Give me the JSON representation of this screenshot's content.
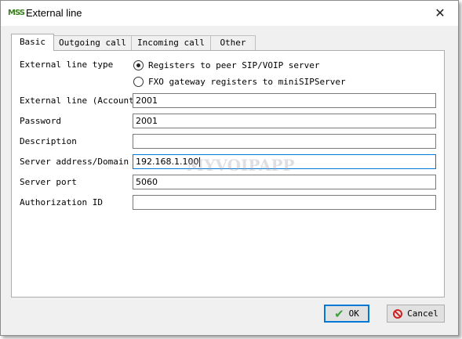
{
  "window": {
    "title": "External line",
    "icon": "mss-logo-icon"
  },
  "tabs": [
    {
      "label": "Basic",
      "active": true
    },
    {
      "label": "Outgoing call",
      "active": false
    },
    {
      "label": "Incoming call",
      "active": false
    },
    {
      "label": "Other",
      "active": false
    }
  ],
  "form": {
    "type_label": "External line type",
    "radio_options": [
      {
        "label": "Registers to peer SIP/VOIP server",
        "checked": true
      },
      {
        "label": "FXO gateway registers to miniSIPServer",
        "checked": false
      }
    ],
    "fields": [
      {
        "label": "External line (Account)",
        "value": "2001"
      },
      {
        "label": "Password",
        "value": "2001"
      },
      {
        "label": "Description",
        "value": ""
      },
      {
        "label": "Server address/Domain",
        "value": "192.168.1.100",
        "focused": true
      },
      {
        "label": "Server port",
        "value": "5060"
      },
      {
        "label": "Authorization ID",
        "value": ""
      }
    ]
  },
  "watermark": "MYVOIPAPP",
  "buttons": {
    "ok": "OK",
    "cancel": "Cancel"
  }
}
